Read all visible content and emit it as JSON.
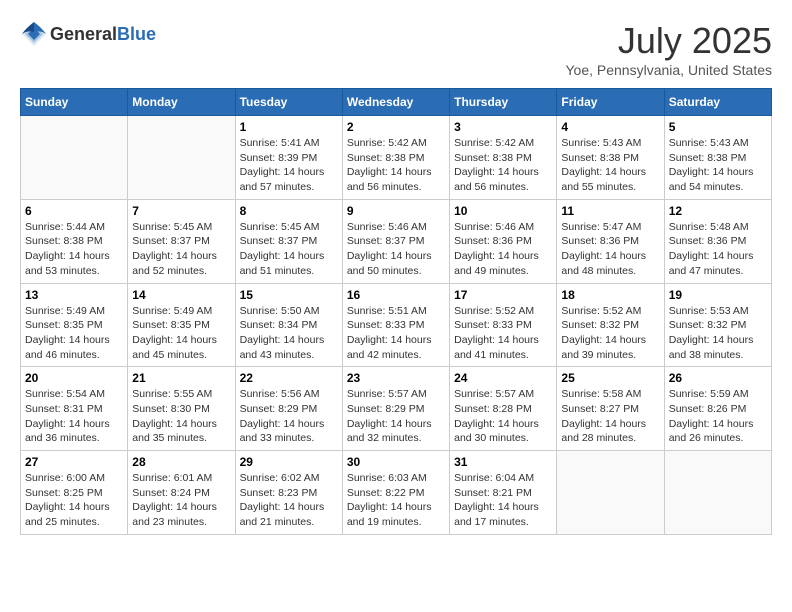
{
  "header": {
    "logo_general": "General",
    "logo_blue": "Blue",
    "month": "July 2025",
    "location": "Yoe, Pennsylvania, United States"
  },
  "weekdays": [
    "Sunday",
    "Monday",
    "Tuesday",
    "Wednesday",
    "Thursday",
    "Friday",
    "Saturday"
  ],
  "weeks": [
    [
      {
        "day": "",
        "sunrise": "",
        "sunset": "",
        "daylight": ""
      },
      {
        "day": "",
        "sunrise": "",
        "sunset": "",
        "daylight": ""
      },
      {
        "day": "1",
        "sunrise": "Sunrise: 5:41 AM",
        "sunset": "Sunset: 8:39 PM",
        "daylight": "Daylight: 14 hours and 57 minutes."
      },
      {
        "day": "2",
        "sunrise": "Sunrise: 5:42 AM",
        "sunset": "Sunset: 8:38 PM",
        "daylight": "Daylight: 14 hours and 56 minutes."
      },
      {
        "day": "3",
        "sunrise": "Sunrise: 5:42 AM",
        "sunset": "Sunset: 8:38 PM",
        "daylight": "Daylight: 14 hours and 56 minutes."
      },
      {
        "day": "4",
        "sunrise": "Sunrise: 5:43 AM",
        "sunset": "Sunset: 8:38 PM",
        "daylight": "Daylight: 14 hours and 55 minutes."
      },
      {
        "day": "5",
        "sunrise": "Sunrise: 5:43 AM",
        "sunset": "Sunset: 8:38 PM",
        "daylight": "Daylight: 14 hours and 54 minutes."
      }
    ],
    [
      {
        "day": "6",
        "sunrise": "Sunrise: 5:44 AM",
        "sunset": "Sunset: 8:38 PM",
        "daylight": "Daylight: 14 hours and 53 minutes."
      },
      {
        "day": "7",
        "sunrise": "Sunrise: 5:45 AM",
        "sunset": "Sunset: 8:37 PM",
        "daylight": "Daylight: 14 hours and 52 minutes."
      },
      {
        "day": "8",
        "sunrise": "Sunrise: 5:45 AM",
        "sunset": "Sunset: 8:37 PM",
        "daylight": "Daylight: 14 hours and 51 minutes."
      },
      {
        "day": "9",
        "sunrise": "Sunrise: 5:46 AM",
        "sunset": "Sunset: 8:37 PM",
        "daylight": "Daylight: 14 hours and 50 minutes."
      },
      {
        "day": "10",
        "sunrise": "Sunrise: 5:46 AM",
        "sunset": "Sunset: 8:36 PM",
        "daylight": "Daylight: 14 hours and 49 minutes."
      },
      {
        "day": "11",
        "sunrise": "Sunrise: 5:47 AM",
        "sunset": "Sunset: 8:36 PM",
        "daylight": "Daylight: 14 hours and 48 minutes."
      },
      {
        "day": "12",
        "sunrise": "Sunrise: 5:48 AM",
        "sunset": "Sunset: 8:36 PM",
        "daylight": "Daylight: 14 hours and 47 minutes."
      }
    ],
    [
      {
        "day": "13",
        "sunrise": "Sunrise: 5:49 AM",
        "sunset": "Sunset: 8:35 PM",
        "daylight": "Daylight: 14 hours and 46 minutes."
      },
      {
        "day": "14",
        "sunrise": "Sunrise: 5:49 AM",
        "sunset": "Sunset: 8:35 PM",
        "daylight": "Daylight: 14 hours and 45 minutes."
      },
      {
        "day": "15",
        "sunrise": "Sunrise: 5:50 AM",
        "sunset": "Sunset: 8:34 PM",
        "daylight": "Daylight: 14 hours and 43 minutes."
      },
      {
        "day": "16",
        "sunrise": "Sunrise: 5:51 AM",
        "sunset": "Sunset: 8:33 PM",
        "daylight": "Daylight: 14 hours and 42 minutes."
      },
      {
        "day": "17",
        "sunrise": "Sunrise: 5:52 AM",
        "sunset": "Sunset: 8:33 PM",
        "daylight": "Daylight: 14 hours and 41 minutes."
      },
      {
        "day": "18",
        "sunrise": "Sunrise: 5:52 AM",
        "sunset": "Sunset: 8:32 PM",
        "daylight": "Daylight: 14 hours and 39 minutes."
      },
      {
        "day": "19",
        "sunrise": "Sunrise: 5:53 AM",
        "sunset": "Sunset: 8:32 PM",
        "daylight": "Daylight: 14 hours and 38 minutes."
      }
    ],
    [
      {
        "day": "20",
        "sunrise": "Sunrise: 5:54 AM",
        "sunset": "Sunset: 8:31 PM",
        "daylight": "Daylight: 14 hours and 36 minutes."
      },
      {
        "day": "21",
        "sunrise": "Sunrise: 5:55 AM",
        "sunset": "Sunset: 8:30 PM",
        "daylight": "Daylight: 14 hours and 35 minutes."
      },
      {
        "day": "22",
        "sunrise": "Sunrise: 5:56 AM",
        "sunset": "Sunset: 8:29 PM",
        "daylight": "Daylight: 14 hours and 33 minutes."
      },
      {
        "day": "23",
        "sunrise": "Sunrise: 5:57 AM",
        "sunset": "Sunset: 8:29 PM",
        "daylight": "Daylight: 14 hours and 32 minutes."
      },
      {
        "day": "24",
        "sunrise": "Sunrise: 5:57 AM",
        "sunset": "Sunset: 8:28 PM",
        "daylight": "Daylight: 14 hours and 30 minutes."
      },
      {
        "day": "25",
        "sunrise": "Sunrise: 5:58 AM",
        "sunset": "Sunset: 8:27 PM",
        "daylight": "Daylight: 14 hours and 28 minutes."
      },
      {
        "day": "26",
        "sunrise": "Sunrise: 5:59 AM",
        "sunset": "Sunset: 8:26 PM",
        "daylight": "Daylight: 14 hours and 26 minutes."
      }
    ],
    [
      {
        "day": "27",
        "sunrise": "Sunrise: 6:00 AM",
        "sunset": "Sunset: 8:25 PM",
        "daylight": "Daylight: 14 hours and 25 minutes."
      },
      {
        "day": "28",
        "sunrise": "Sunrise: 6:01 AM",
        "sunset": "Sunset: 8:24 PM",
        "daylight": "Daylight: 14 hours and 23 minutes."
      },
      {
        "day": "29",
        "sunrise": "Sunrise: 6:02 AM",
        "sunset": "Sunset: 8:23 PM",
        "daylight": "Daylight: 14 hours and 21 minutes."
      },
      {
        "day": "30",
        "sunrise": "Sunrise: 6:03 AM",
        "sunset": "Sunset: 8:22 PM",
        "daylight": "Daylight: 14 hours and 19 minutes."
      },
      {
        "day": "31",
        "sunrise": "Sunrise: 6:04 AM",
        "sunset": "Sunset: 8:21 PM",
        "daylight": "Daylight: 14 hours and 17 minutes."
      },
      {
        "day": "",
        "sunrise": "",
        "sunset": "",
        "daylight": ""
      },
      {
        "day": "",
        "sunrise": "",
        "sunset": "",
        "daylight": ""
      }
    ]
  ]
}
